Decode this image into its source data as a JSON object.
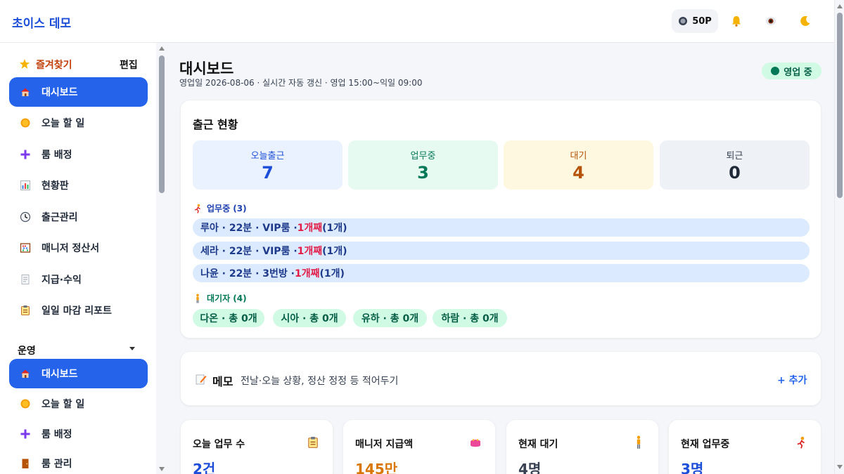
{
  "app": {
    "brand": "초이스 데모"
  },
  "topbar": {
    "points": "50P"
  },
  "sidebar": {
    "favorites_label": "즐겨찾기",
    "edit_label": "편집",
    "favorites": [
      {
        "label": "대시보드",
        "icon": "house-icon"
      },
      {
        "label": "오늘 할 일",
        "icon": "sun-icon"
      },
      {
        "label": "룸 배정",
        "icon": "plus-icon"
      },
      {
        "label": "현황판",
        "icon": "bar-chart-icon"
      },
      {
        "label": "출근관리",
        "icon": "clock-icon"
      },
      {
        "label": "매니저 정산서",
        "icon": "abacus-icon"
      },
      {
        "label": "지급·수익",
        "icon": "receipt-icon"
      },
      {
        "label": "일일 마감 리포트",
        "icon": "clipboard-icon"
      }
    ],
    "section_label": "운영",
    "operations": [
      {
        "label": "대시보드",
        "icon": "house-icon"
      },
      {
        "label": "오늘 할 일",
        "icon": "sun-icon"
      },
      {
        "label": "룸 배정",
        "icon": "plus-icon"
      },
      {
        "label": "룸 관리",
        "icon": "door-icon"
      }
    ]
  },
  "header": {
    "title": "대시보드",
    "subtitle": "영업일 2026-08-06 · 실시간 자동 갱신 · 영업 15:00~익일 09:00",
    "status": "영업 중"
  },
  "attendance": {
    "title": "출근 현황",
    "stats": [
      {
        "label": "오늘출근",
        "value": "7"
      },
      {
        "label": "업무중",
        "value": "3"
      },
      {
        "label": "대기",
        "value": "4"
      },
      {
        "label": "퇴근",
        "value": "0"
      }
    ],
    "working_title": "업무중 (3)",
    "working": [
      {
        "text": "루아 · 22분 · VIP룸 · ",
        "highlight": "1개째",
        "count": "(1개)"
      },
      {
        "text": "세라 · 22분 · VIP룸 · ",
        "highlight": "1개째",
        "count": "(1개)"
      },
      {
        "text": "나윤 · 22분 · 3번방 · ",
        "highlight": "1개째",
        "count": "(1개)"
      }
    ],
    "waiting_title": "대기자 (4)",
    "waiting": [
      "다온 · 총 0개",
      "시아 · 총 0개",
      "유하 · 총 0개",
      "하람 · 총 0개"
    ]
  },
  "memo": {
    "title": "메모",
    "description": "전날·오늘 상황, 정산 정정 등 적어두기",
    "add_label": "+ 추가"
  },
  "kpis": [
    {
      "label": "오늘 업무 수",
      "value": "2건",
      "icon": "clipboard-icon",
      "color": "#1d4ed8"
    },
    {
      "label": "매니저 지급액",
      "value": "145만",
      "icon": "purse-icon",
      "color": "#d97706"
    },
    {
      "label": "현재 대기",
      "value": "4명",
      "icon": "standing-person-icon",
      "color": "#374151"
    },
    {
      "label": "현재 업무중",
      "value": "3명",
      "icon": "running-person-icon",
      "color": "#1d4ed8"
    }
  ],
  "colors": {
    "accent": "#2563eb",
    "stat_backgrounds": [
      "#eaf2ff",
      "#e7faf1",
      "#fff8e1",
      "#eef1f5"
    ],
    "stat_label_colors": [
      "#1d4ed8",
      "#047857",
      "#b45309",
      "#374151"
    ],
    "stat_value_colors": [
      "#1d4ed8",
      "#047857",
      "#b45309",
      "#1f2937"
    ]
  }
}
